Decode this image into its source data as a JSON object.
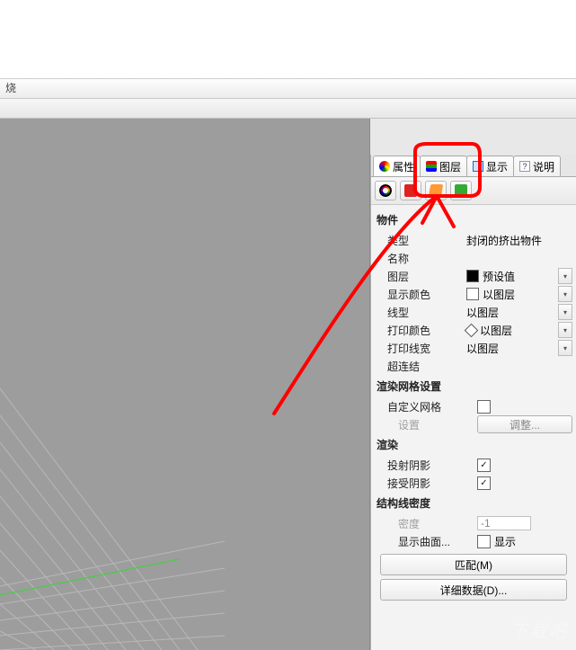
{
  "titlebar": {
    "fragment": "烧"
  },
  "tabs": {
    "properties": "属性",
    "layers": "图层",
    "display": "显示",
    "help": "说明"
  },
  "section_object": "物件",
  "rows": {
    "type": {
      "label": "类型",
      "value": "封闭的挤出物件"
    },
    "name": {
      "label": "名称",
      "value": ""
    },
    "layer": {
      "label": "图层",
      "value": "预设值"
    },
    "disp_color": {
      "label": "显示颜色",
      "value": "以图层"
    },
    "linetype": {
      "label": "线型",
      "value": "以图层"
    },
    "print_color": {
      "label": "打印颜色",
      "value": "以图层"
    },
    "print_width": {
      "label": "打印线宽",
      "value": "以图层"
    },
    "hyperlink": {
      "label": "超连结",
      "value": ""
    }
  },
  "section_render_mesh": "渲染网格设置",
  "custom_mesh": {
    "label": "自定义网格"
  },
  "settings_row": {
    "label": "设置",
    "button": "调整..."
  },
  "section_render": "渲染",
  "cast_shadow": {
    "label": "投射阴影"
  },
  "receive_shadow": {
    "label": "接受阴影"
  },
  "section_isocurve": "结构线密度",
  "density": {
    "label": "密度",
    "value": "-1"
  },
  "show_surface_iso": {
    "label": "显示曲面...",
    "checkbox_label": "显示"
  },
  "buttons": {
    "match": "匹配(M)",
    "details": "详细数据(D)..."
  },
  "watermark": "下载吧"
}
